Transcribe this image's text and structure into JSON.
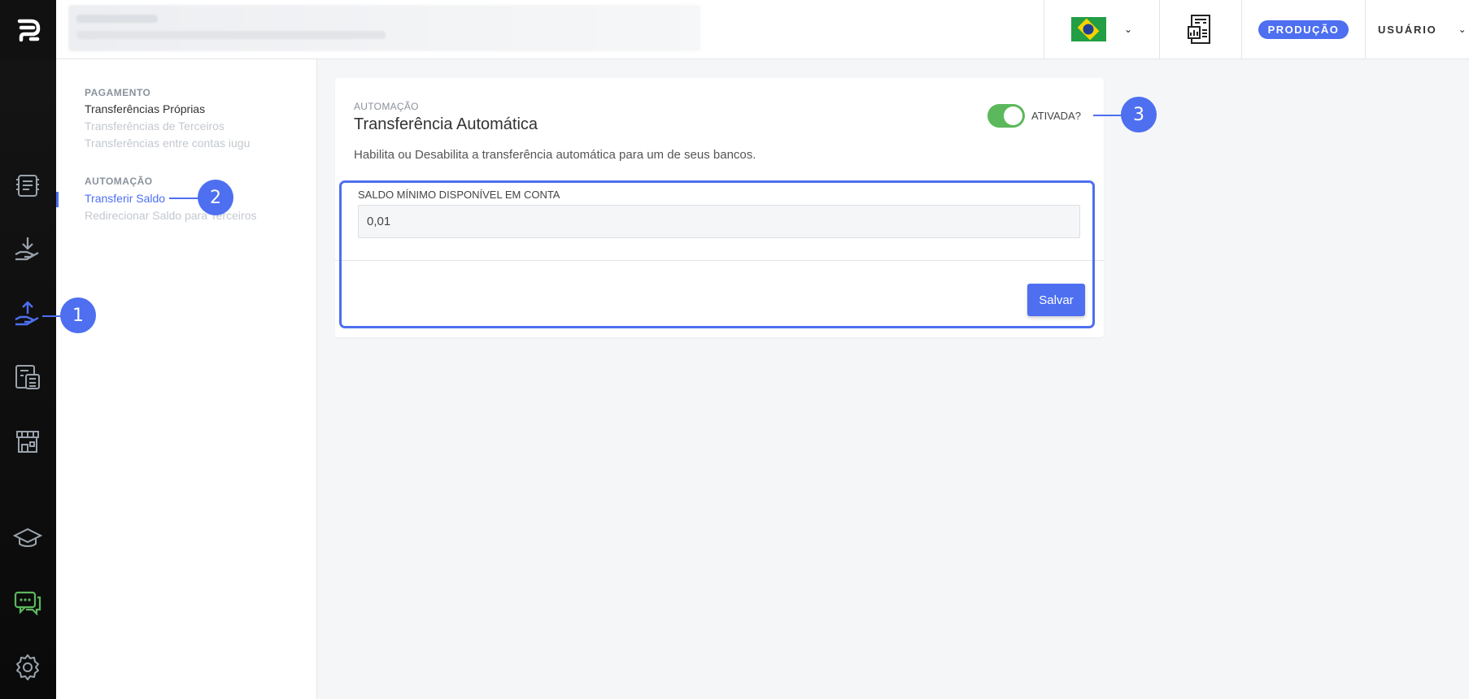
{
  "topbar": {
    "env_badge": "PRODUÇÃO",
    "user_label": "USUÁRIO"
  },
  "submenu": {
    "sections": [
      {
        "heading": "PAGAMENTO",
        "items": [
          {
            "label": "Transferências Próprias"
          },
          {
            "label": "Transferências de Terceiros"
          },
          {
            "label": "Transferências entre contas iugu"
          }
        ]
      },
      {
        "heading": "AUTOMAÇÃO",
        "items": [
          {
            "label": "Transferir Saldo"
          },
          {
            "label": "Redirecionar Saldo para Terceiros"
          }
        ]
      }
    ]
  },
  "card": {
    "eyebrow": "AUTOMAÇÃO",
    "title": "Transferência Automática",
    "description": "Habilita ou Desabilita a transferência automática para um de seus bancos.",
    "toggle_label": "ATIVADA?",
    "toggle_on": true,
    "field_label": "SALDO MÍNIMO DISPONÍVEL EM CONTA",
    "field_value": "0,01",
    "save_label": "Salvar"
  },
  "callouts": [
    "1",
    "2",
    "3"
  ],
  "colors": {
    "accent": "#4d6ff0",
    "toggle_on": "#5cb85c",
    "rail_bg": "#111111"
  }
}
